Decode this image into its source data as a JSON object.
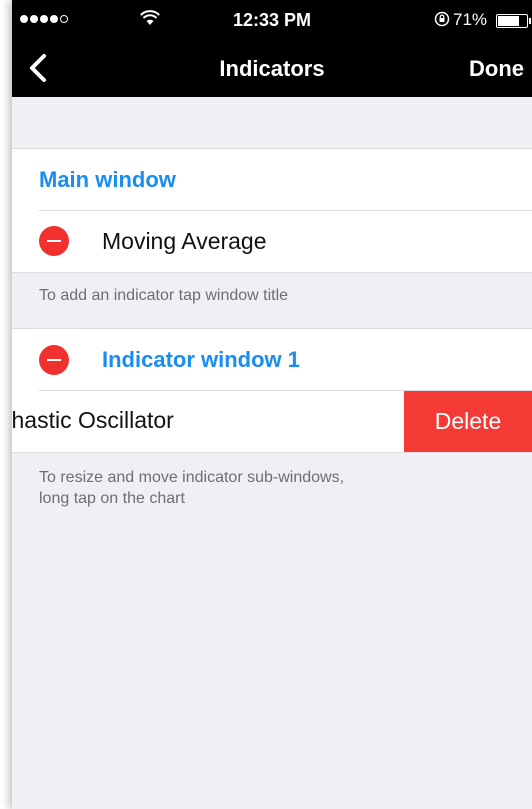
{
  "status_bar": {
    "time": "12:33 PM",
    "battery_percent": "71%",
    "battery_level": 0.71,
    "signal_bars_filled": 4,
    "signal_bars_total": 5
  },
  "nav": {
    "back_icon": "chevron-left-icon",
    "title": "Indicators",
    "done_label": "Done"
  },
  "main_window": {
    "header": "Main window",
    "items": [
      {
        "label": "Moving Average",
        "icon": "minus-circle-icon"
      }
    ],
    "hint": "To add an indicator tap window title"
  },
  "indicator_window": {
    "header": "Indicator window 1",
    "header_icon": "minus-circle-icon",
    "items": [
      {
        "label": "Stochastic Oscillator",
        "visible_label": "chastic Oscillator",
        "delete_label": "Delete"
      }
    ],
    "hint_line1": "To resize and move indicator sub-windows,",
    "hint_line2": "long tap on the chart"
  },
  "colors": {
    "accent_blue": "#1a8df2",
    "delete_red": "#f43a35",
    "minus_red": "#f0312e",
    "bar_black": "#000000",
    "background": "#efeff4"
  }
}
